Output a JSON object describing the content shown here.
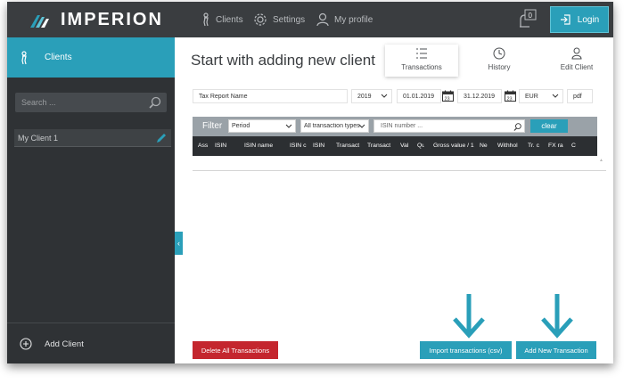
{
  "app": {
    "brand": "IMPERION"
  },
  "nav": {
    "clients": "Clients",
    "settings": "Settings",
    "profile": "My profile",
    "notification_count": "0",
    "login": "Login"
  },
  "sidebar": {
    "active_item": "Clients",
    "search_placeholder": "Search ...",
    "clients": [
      {
        "name": "My Client 1"
      }
    ],
    "add_client": "Add Client"
  },
  "main": {
    "title": "Start with adding new client",
    "tabs": [
      {
        "label": "Transactions",
        "active": true
      },
      {
        "label": "History",
        "active": false
      },
      {
        "label": "Edit Client",
        "active": false
      }
    ]
  },
  "report": {
    "name": "Tax Report Name",
    "year": "2019",
    "date_from": "01.01.2019",
    "calendar_day": "23",
    "date_to": "31.12.2019",
    "currency": "EUR",
    "format": "pdf"
  },
  "filter": {
    "label": "Filter",
    "period": "Period",
    "transaction_type": "All transaction types",
    "isin_placeholder": "ISIN number ...",
    "clear": "clear"
  },
  "table": {
    "columns": [
      "Ass",
      "ISIN",
      "ISIN name",
      "ISIN c",
      "ISIN",
      "Transact",
      "Transact",
      "Val",
      "Qu",
      "Gross value / 1",
      "Ne",
      "Withhol",
      "Tr. c",
      "FX ra",
      "C"
    ]
  },
  "actions": {
    "delete_all": "Delete All Transactions",
    "import_csv": "Import transactions (csv)",
    "add_new": "Add New Transaction"
  },
  "colors": {
    "accent": "#2a9fb9",
    "danger": "#c4262e",
    "topbar": "#3a3d40",
    "sidebar": "#2f3235"
  }
}
